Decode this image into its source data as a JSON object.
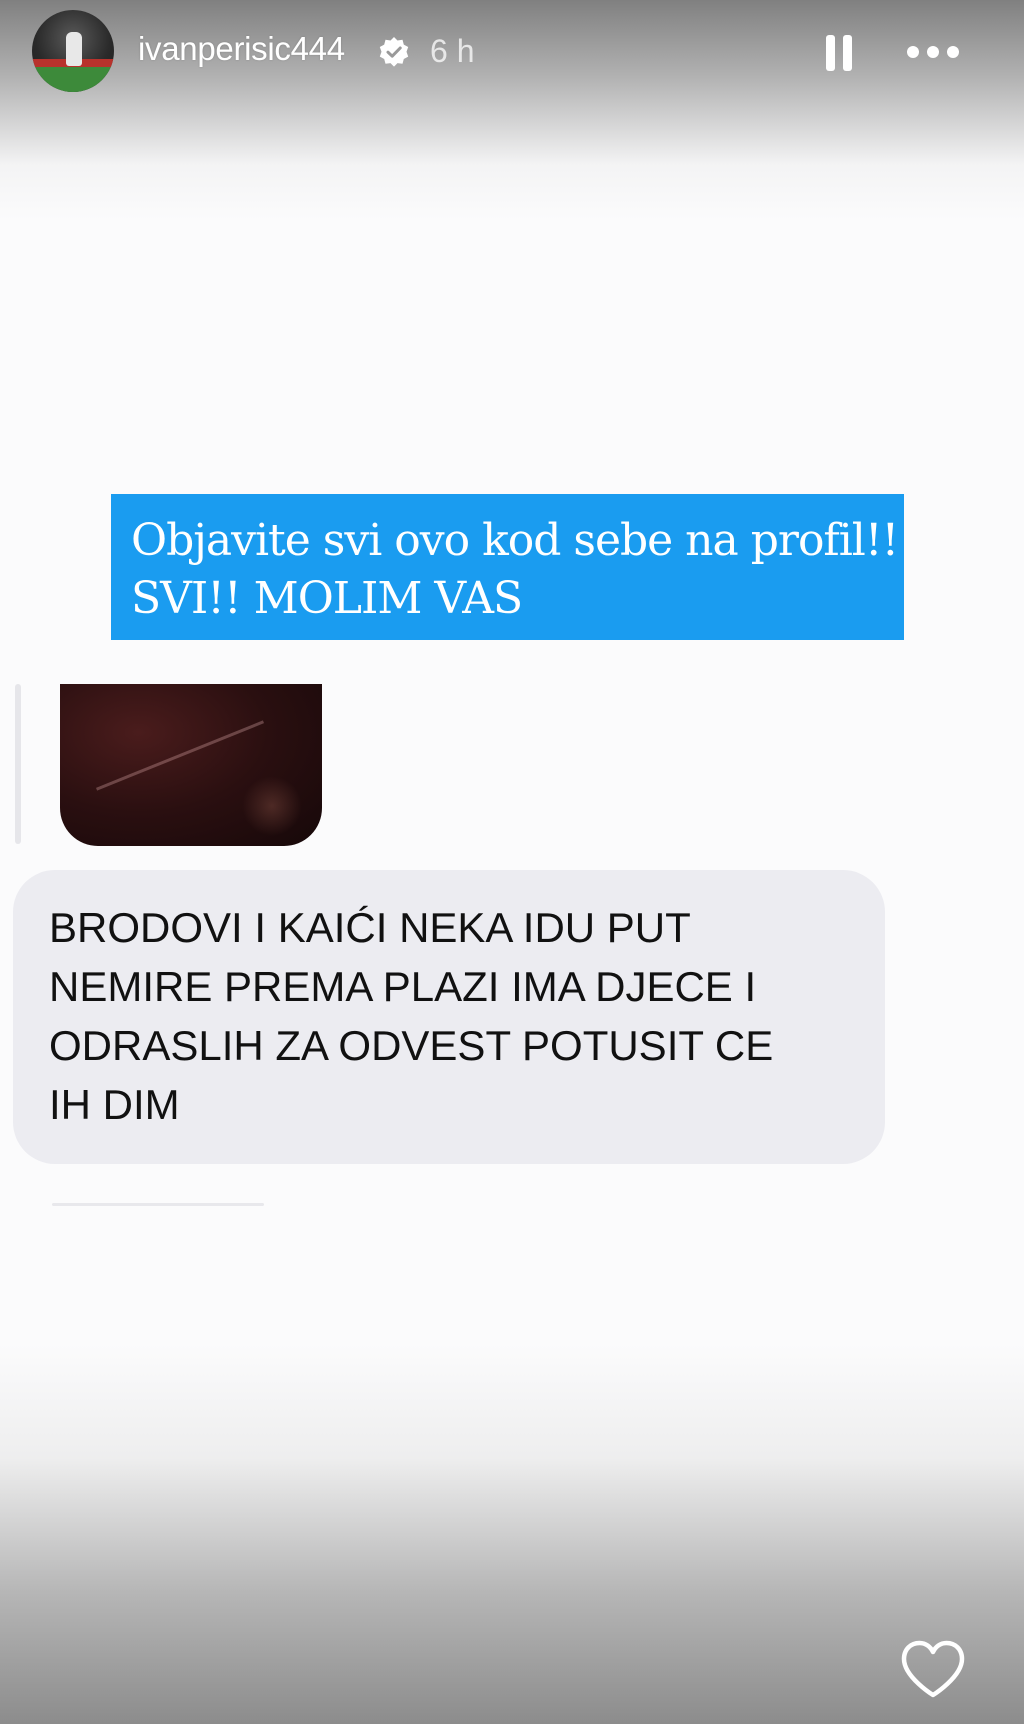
{
  "header": {
    "username": "ivanperisic444",
    "time_ago": "6 h",
    "avatar_icon": "avatar-image",
    "verified_icon": "verified-badge-icon",
    "pause_icon": "pause-icon",
    "more_icon": "more-options-icon"
  },
  "caption": {
    "line1": "Objavite svi ovo kod sebe na profil!!",
    "line2": "SVI!! MOLIM VAS",
    "background_color": "#1a9cf0"
  },
  "screenshot": {
    "message": {
      "lines": [
        "BRODOVI I KAIĆI NEKA IDU PUT",
        "NEMIRE PREMA PLAZI IMA DJECE I",
        "ODRASLIH ZA ODVEST POTUSIT CE",
        "IH DIM"
      ]
    },
    "media_icon": "shared-photo-thumbnail"
  },
  "footer": {
    "like_icon": "heart-icon"
  }
}
